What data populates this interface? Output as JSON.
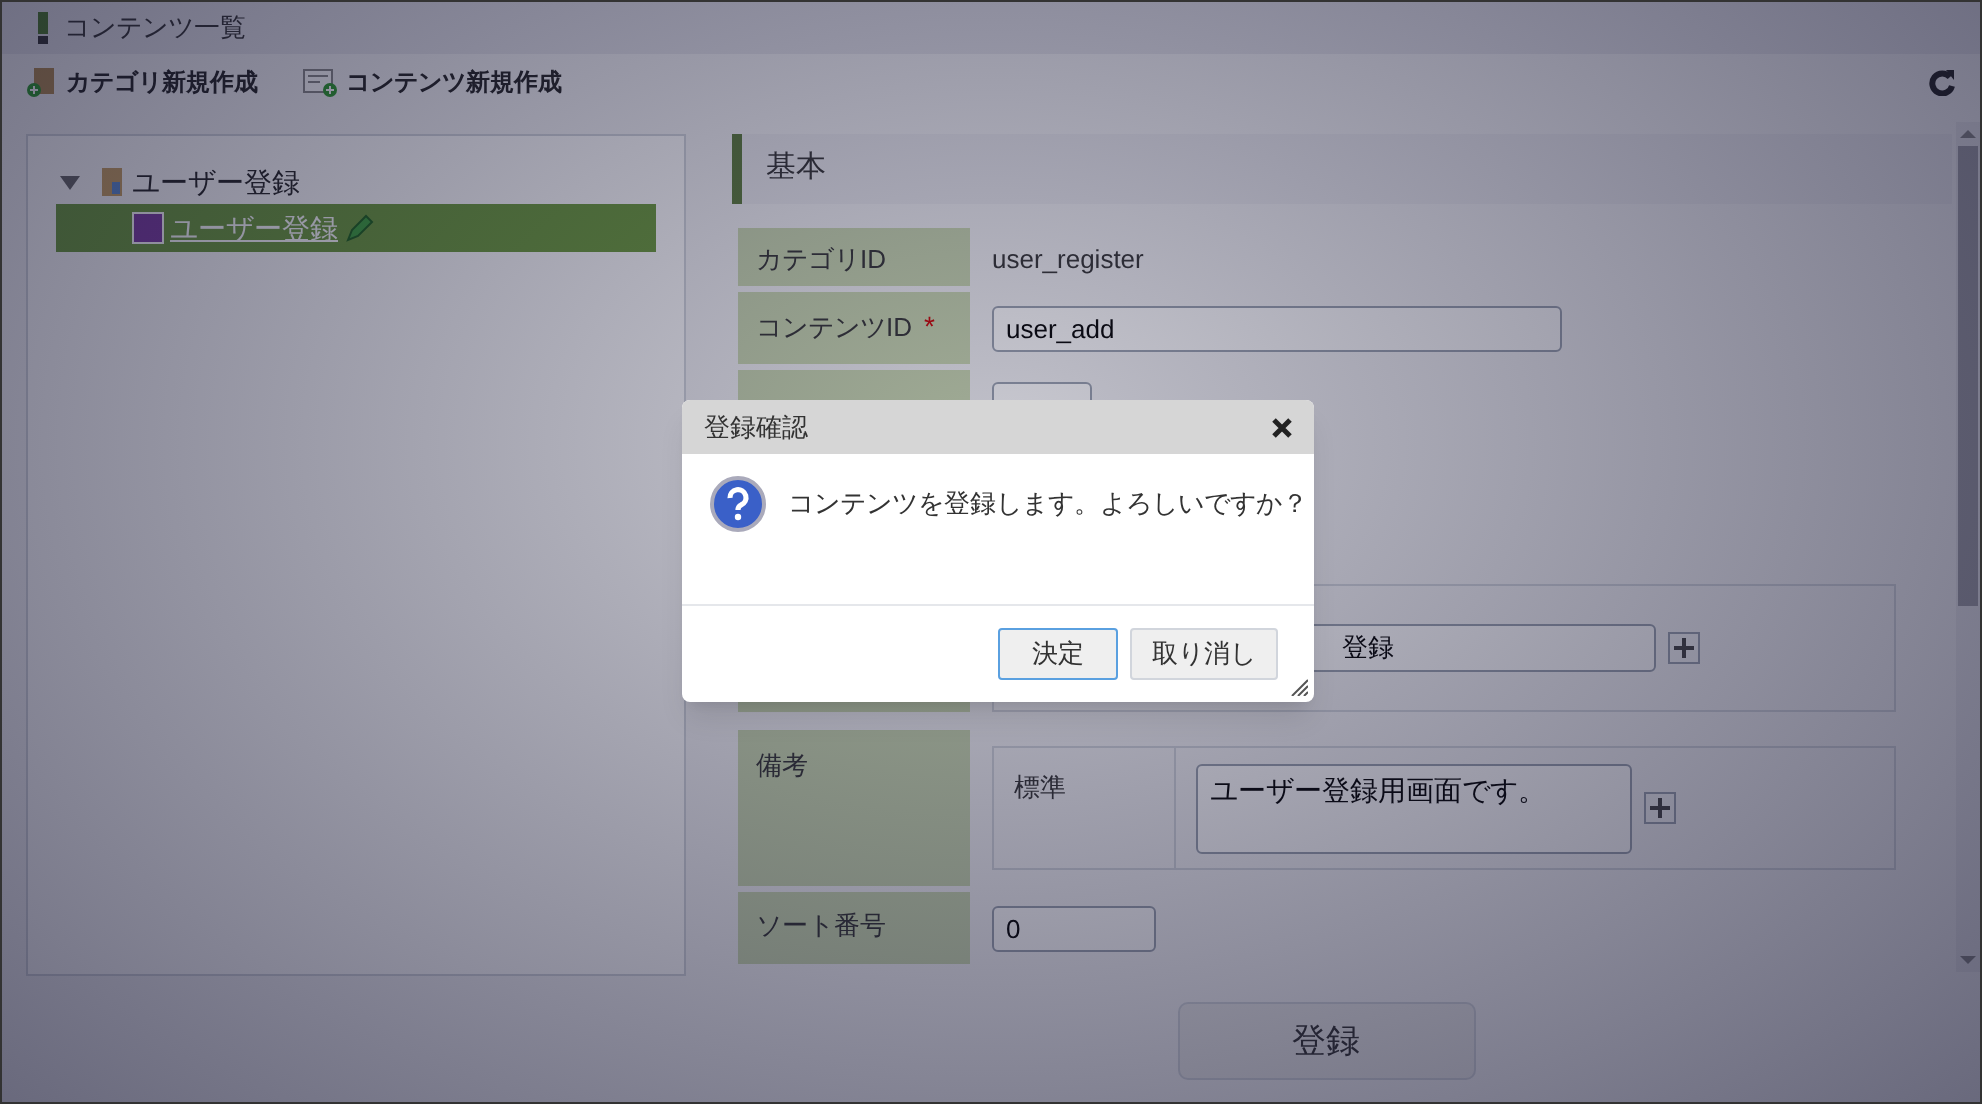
{
  "window": {
    "title": "コンテンツ一覧"
  },
  "toolbar": [
    {
      "kind": "category",
      "label": "カテゴリ新規作成"
    },
    {
      "kind": "content",
      "label": "コンテンツ新規作成"
    }
  ],
  "tree": [
    {
      "label": "ユーザー登録",
      "expanded": true,
      "children": [
        {
          "label": "ユーザー登録",
          "selected": true
        }
      ]
    }
  ],
  "section": {
    "title": "基本"
  },
  "form": [
    {
      "kind": "text",
      "label": "カテゴリID",
      "value": "user_register"
    },
    {
      "kind": "input",
      "label": "コンテンツID",
      "required": true,
      "required_mark": "*",
      "value": "user_add"
    },
    {
      "kind": "select"
    },
    {
      "kind": "locale-input",
      "value": "登録"
    },
    {
      "kind": "locale-textarea",
      "label": "備考",
      "locale": "標準",
      "value": "ユーザー登録用画面です。"
    },
    {
      "kind": "input",
      "label": "ソート番号",
      "value": "0"
    }
  ],
  "submit": {
    "label": "登録"
  },
  "dialog": {
    "title": "登録確認",
    "message": "コンテンツを登録します。よろしいですか？",
    "buttons": [
      {
        "label": "決定",
        "focused": true
      },
      {
        "label": "取り消し",
        "focused": false
      }
    ]
  }
}
